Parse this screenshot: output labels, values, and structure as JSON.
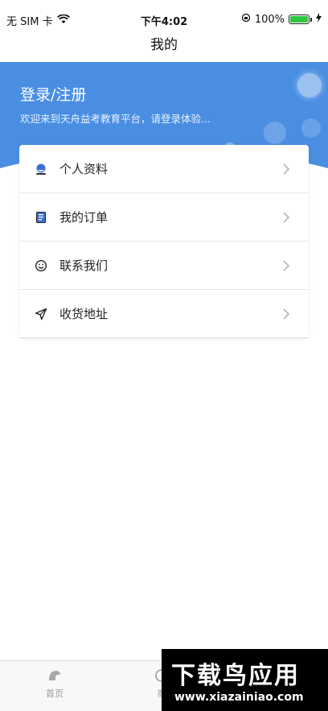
{
  "status_bar": {
    "carrier": "无 SIM 卡",
    "time": "下午4:02",
    "battery_percent": "100%",
    "battery_level": 1.0,
    "icons": [
      "wifi-icon",
      "orientation-lock-icon",
      "battery-icon",
      "charging-icon"
    ]
  },
  "nav": {
    "title": "我的"
  },
  "header": {
    "title": "登录/注册",
    "subtitle": "欢迎来到天舟益考教育平台，请登录体验...",
    "color": "#4a8ee2"
  },
  "menu": {
    "items": [
      {
        "label": "个人资料",
        "icon": "user-icon"
      },
      {
        "label": "我的订单",
        "icon": "order-icon"
      },
      {
        "label": "联系我们",
        "icon": "smile-icon"
      },
      {
        "label": "收货地址",
        "icon": "location-arrow-icon"
      }
    ]
  },
  "tab_bar": {
    "tabs": [
      {
        "label": "首页",
        "icon": "home-icon"
      },
      {
        "label": "商",
        "icon": "mall-icon"
      }
    ]
  },
  "watermark": {
    "title": "下载鸟应用",
    "url": "www.xiazainiao.com"
  }
}
